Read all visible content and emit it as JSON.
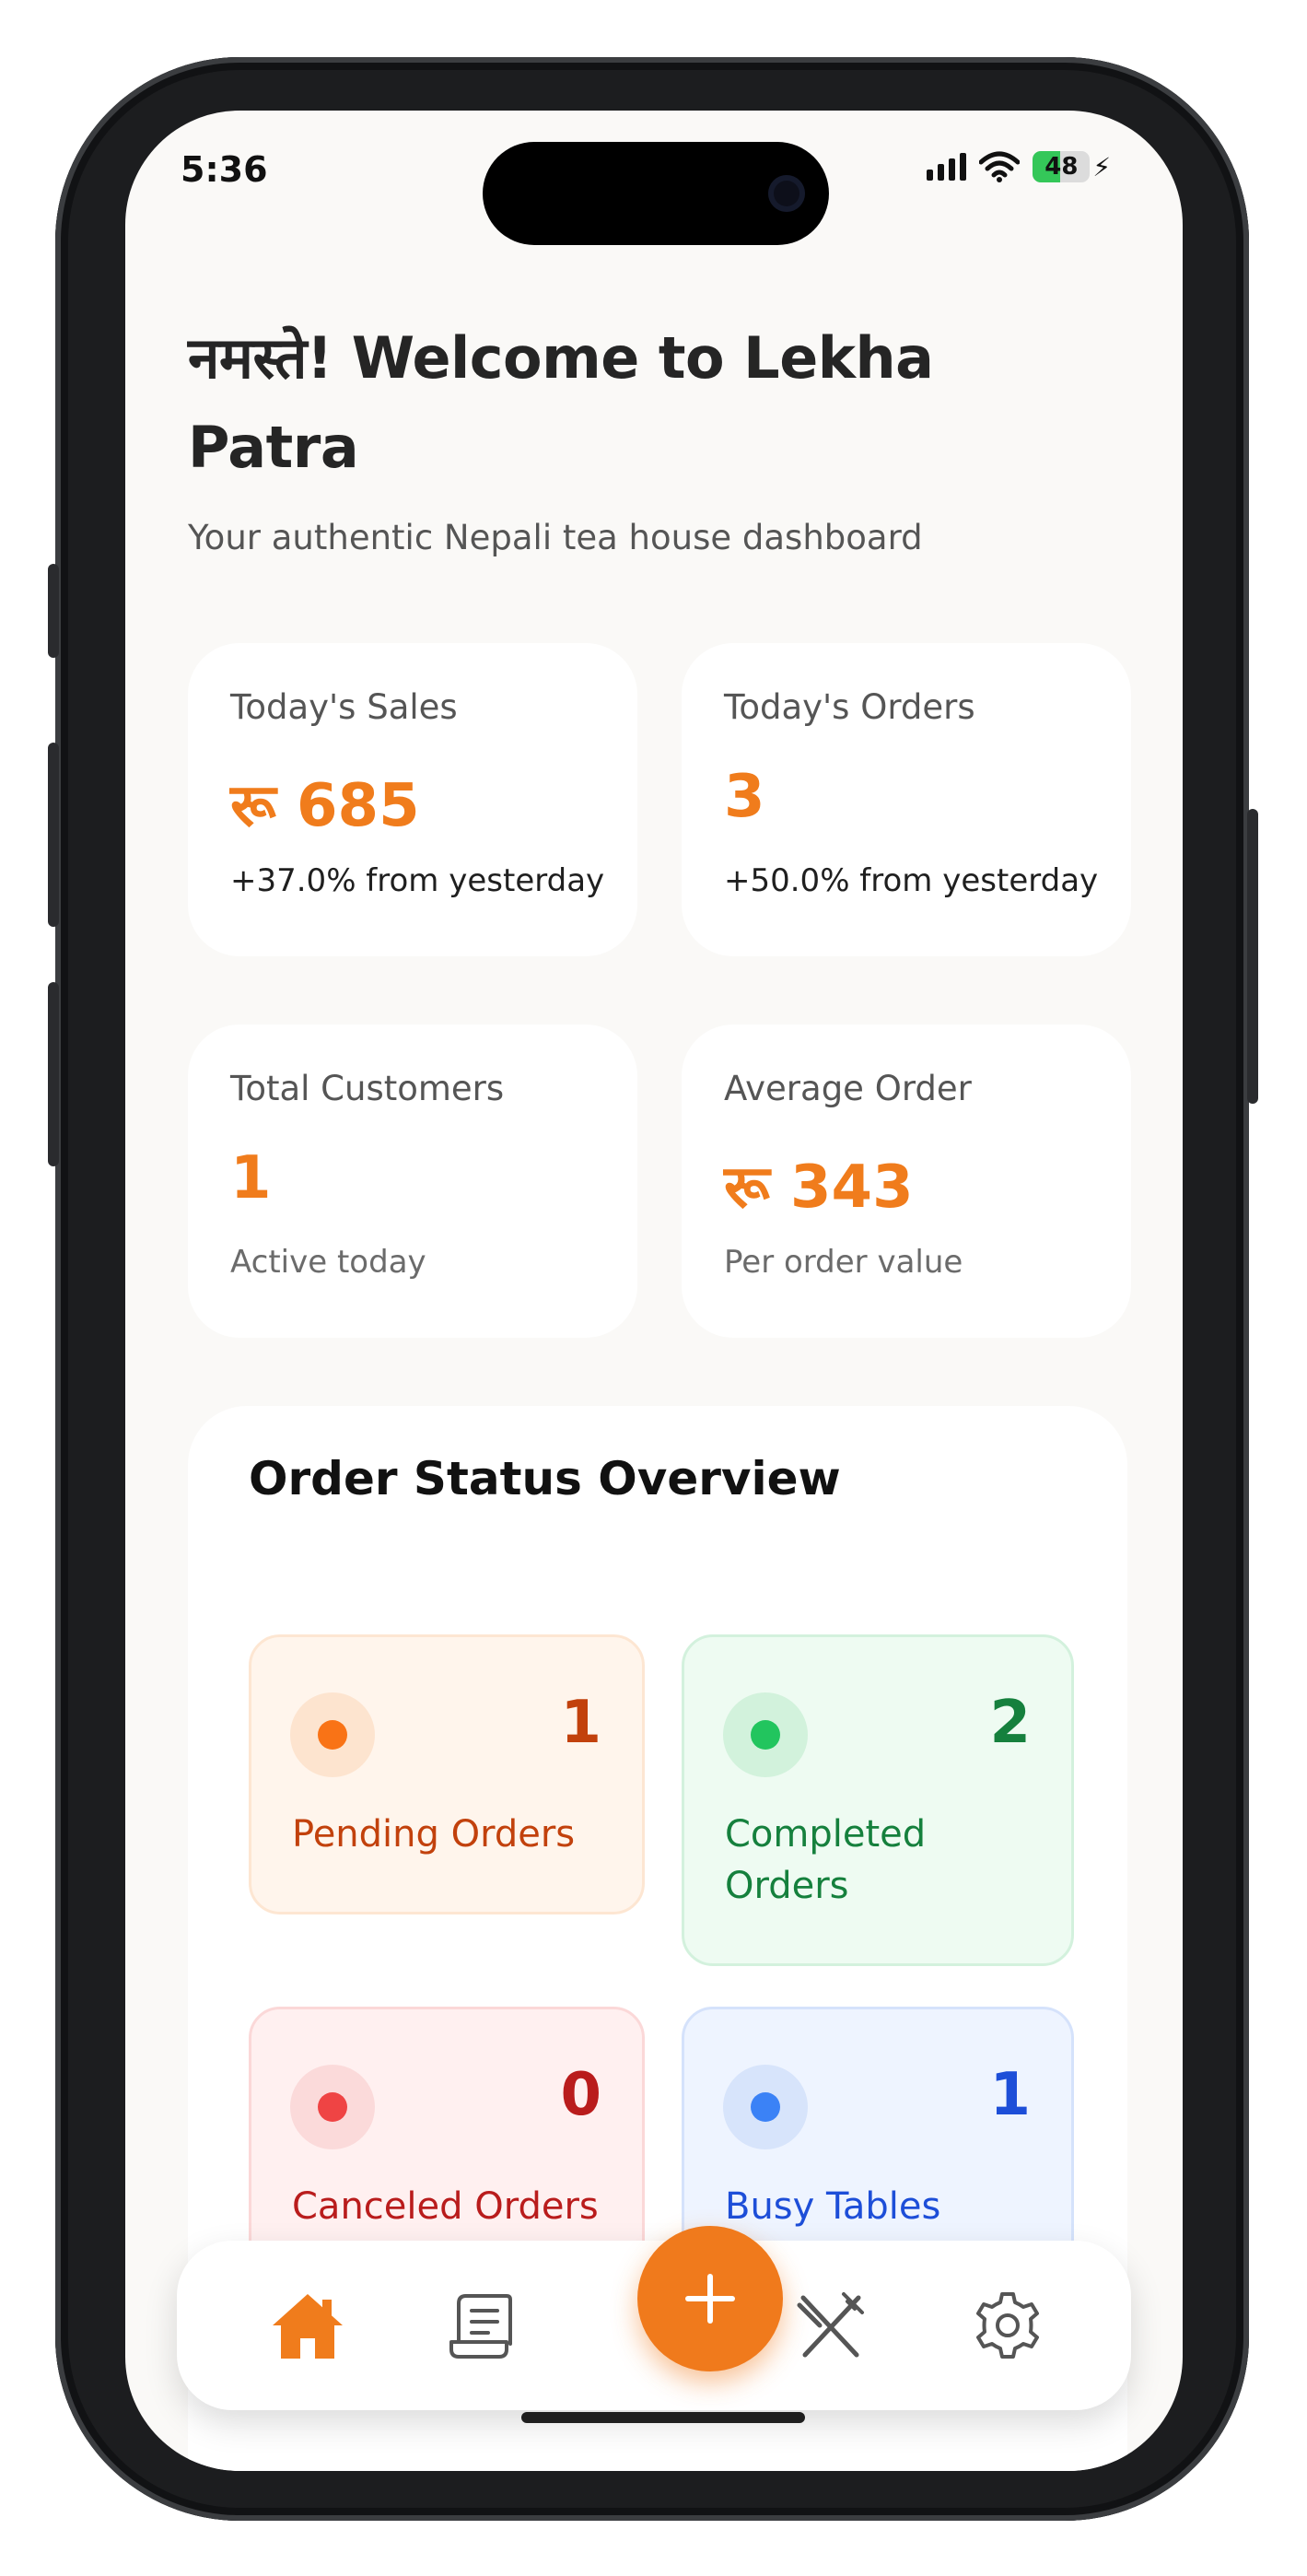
{
  "status_bar": {
    "time": "5:36",
    "battery": "48"
  },
  "header": {
    "title": "नमस्ते! Welcome to Lekha Patra",
    "subtitle": "Your authentic Nepali tea house dashboard"
  },
  "stats": [
    {
      "title": "Today's Sales",
      "value": "रू 685",
      "note": "+37.0% from yesterday"
    },
    {
      "title": "Today's Orders",
      "value": "3",
      "note": "+50.0% from yesterday"
    },
    {
      "title": "Total Customers",
      "value": "1",
      "note": "Active today"
    },
    {
      "title": "Average Order",
      "value": "रू 343",
      "note": "Per order value"
    }
  ],
  "overview": {
    "title": "Order Status Overview",
    "tiles": [
      {
        "label": "Pending Orders",
        "count": "1"
      },
      {
        "label": "Completed Orders",
        "count": "2"
      },
      {
        "label": "Canceled Orders",
        "count": "0"
      },
      {
        "label": "Busy Tables",
        "count": "1"
      }
    ]
  },
  "nav": {
    "items": [
      "home-icon",
      "receipt-icon",
      "add-icon",
      "dining-icon",
      "settings-icon"
    ],
    "active": "home-icon"
  },
  "colors": {
    "accent": "#f07c1c",
    "pending": "#f97316",
    "completed": "#16a34a",
    "canceled": "#dc2626",
    "busy": "#2563eb"
  }
}
